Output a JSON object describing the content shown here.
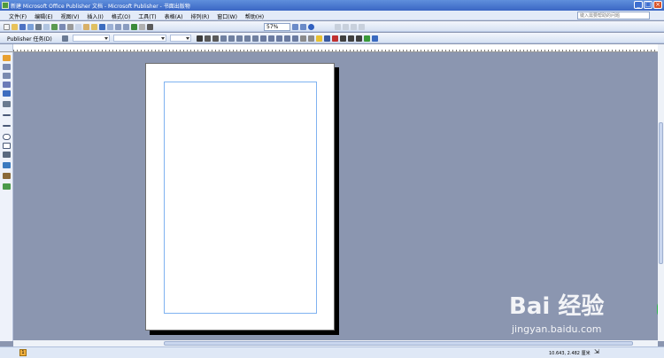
{
  "window": {
    "title": "新建 Microsoft Office Publisher 文档 - Microsoft Publisher - 书面出版物"
  },
  "menu": {
    "items": [
      "文件(F)",
      "编辑(E)",
      "视图(V)",
      "插入(I)",
      "格式(O)",
      "工具(T)",
      "表格(A)",
      "排列(R)",
      "窗口(W)",
      "帮助(H)"
    ],
    "help_placeholder": "键入需要帮助的问题"
  },
  "toolbar": {
    "zoom": "57%",
    "task_pane_label": "Publisher 任务(D)"
  },
  "status": {
    "page_number": "1",
    "coordinates": "10.643, 2.482 厘米"
  },
  "watermark": {
    "logo": "Bai 经验",
    "url": "jingyan.baidu.com"
  },
  "colors": {
    "workspace": "#8b96b0",
    "margin_guide": "#7fb2f0",
    "titlebar": "#3a66c4"
  }
}
